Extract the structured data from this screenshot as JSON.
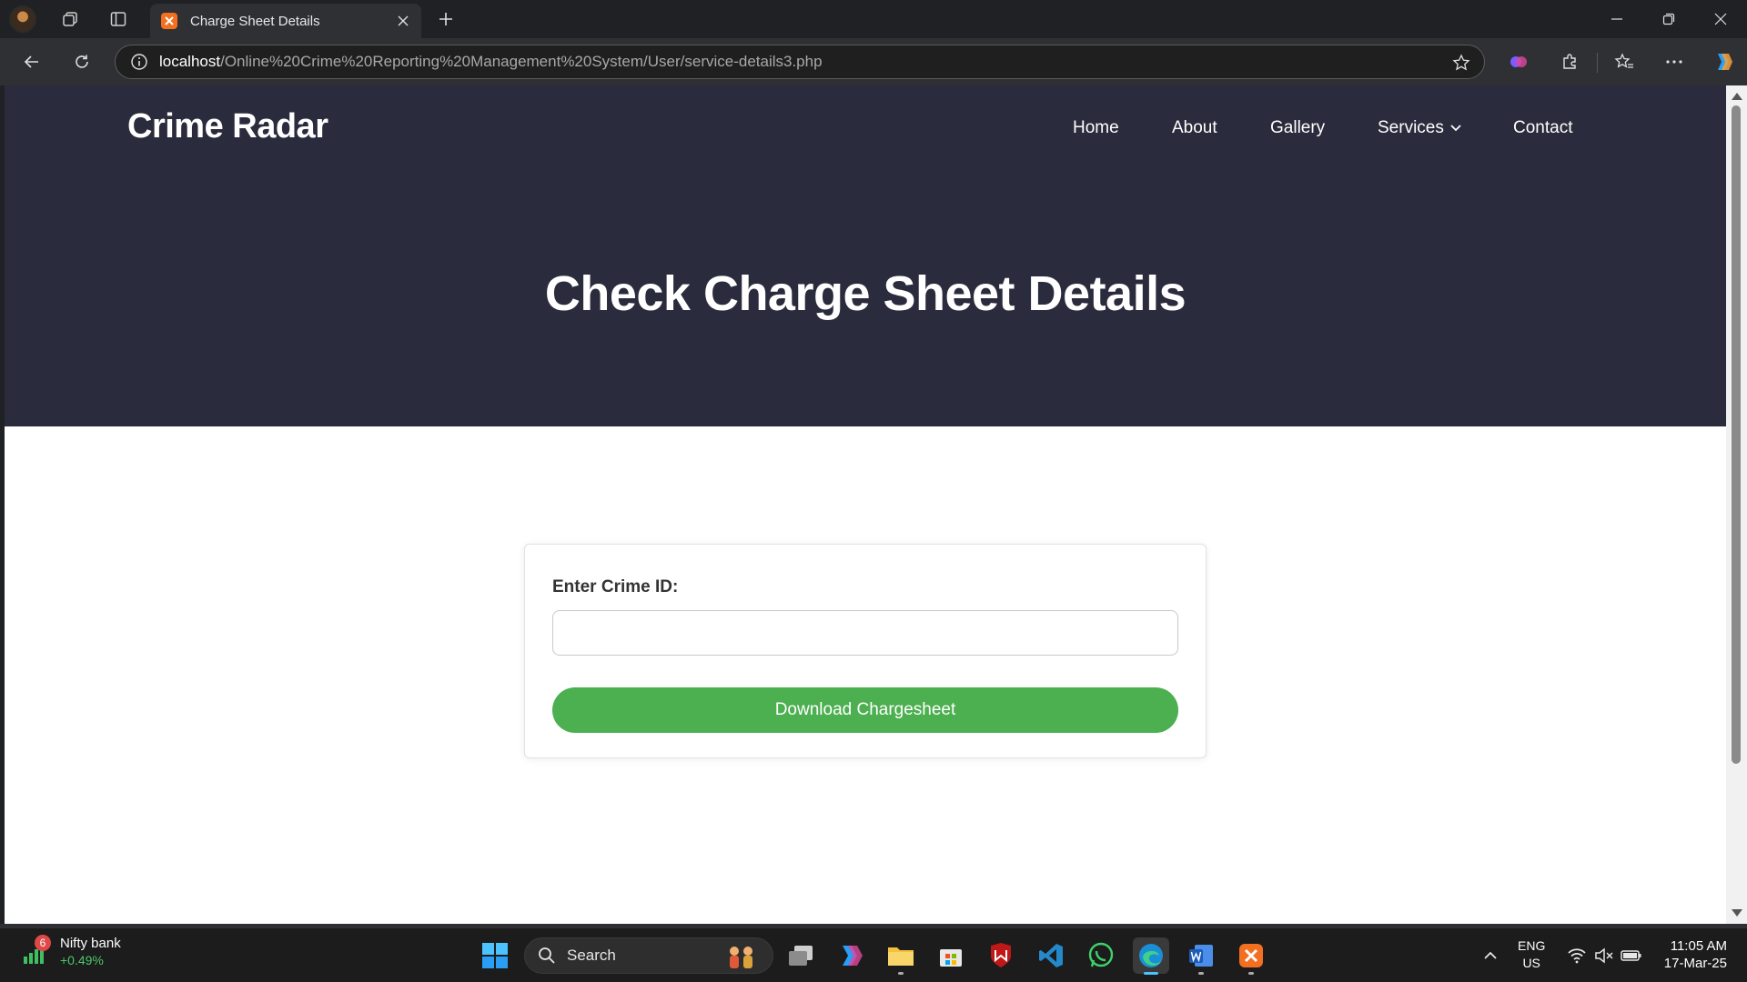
{
  "browser": {
    "tab": {
      "title": "Charge Sheet Details",
      "favicon": "xampp-icon"
    },
    "url": {
      "host": "localhost",
      "path": "/Online%20Crime%20Reporting%20Management%20System/User/service-details3.php"
    }
  },
  "site": {
    "brand": "Crime Radar",
    "nav": [
      {
        "label": "Home"
      },
      {
        "label": "About"
      },
      {
        "label": "Gallery"
      },
      {
        "label": "Services"
      },
      {
        "label": "Contact"
      }
    ],
    "hero_title": "Check Charge Sheet Details"
  },
  "form": {
    "label": "Enter Crime ID:",
    "input_value": "",
    "input_placeholder": "",
    "button_label": "Download Chargesheet",
    "button_color": "#4caf50"
  },
  "colors": {
    "hero_bg": "#2a2b3c",
    "page_bg": "#ffffff"
  },
  "taskbar": {
    "widget": {
      "name": "Nifty bank",
      "change": "+0.49%",
      "badge": "6"
    },
    "search_label": "Search",
    "language": {
      "line1": "ENG",
      "line2": "US"
    },
    "clock": {
      "time": "11:05 AM",
      "date": "17-Mar-25"
    }
  }
}
